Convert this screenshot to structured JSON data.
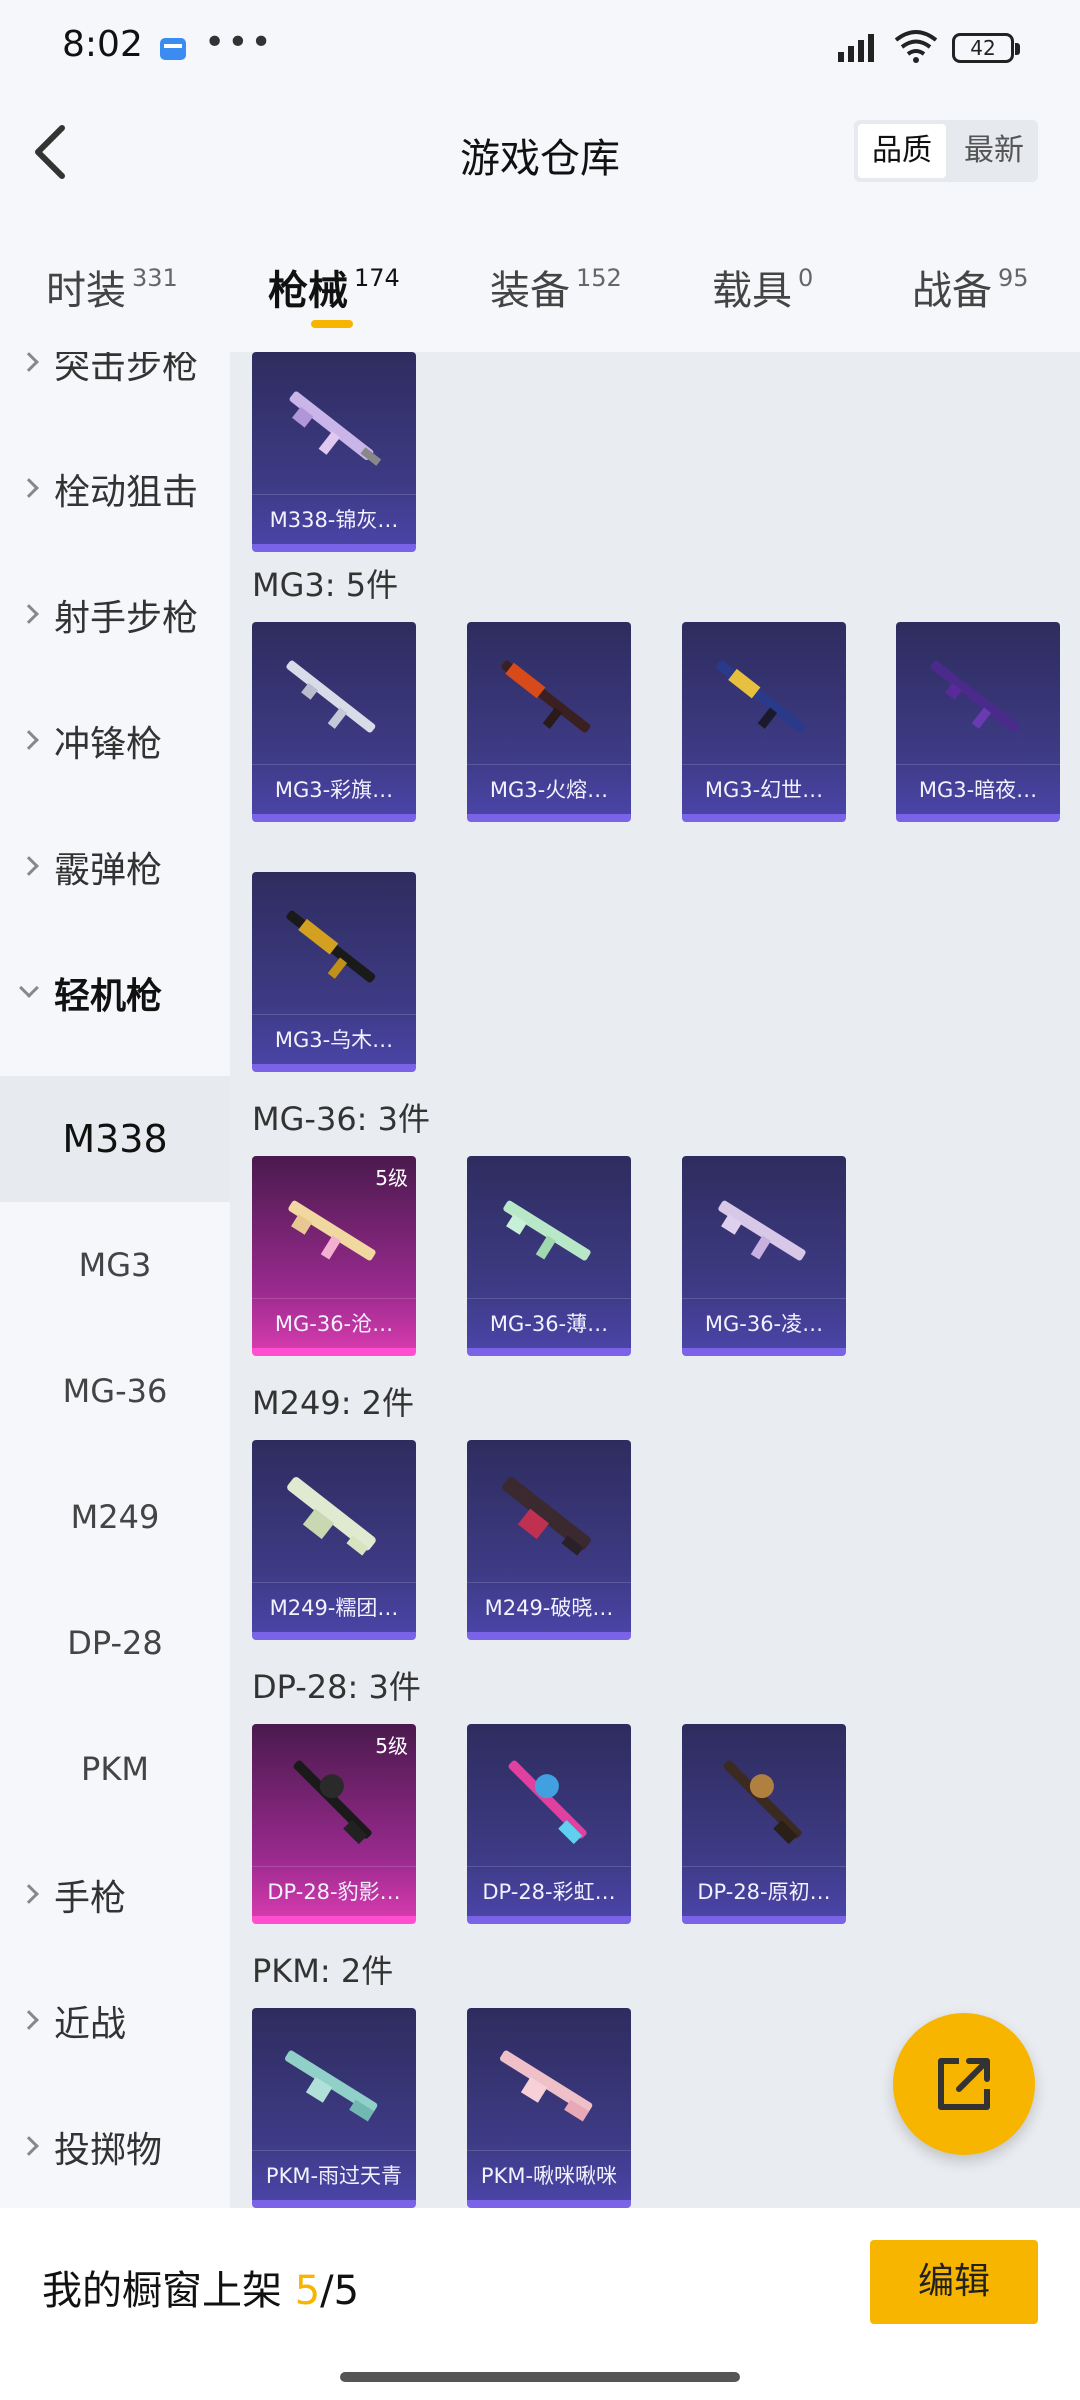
{
  "status_bar": {
    "time": "8:02",
    "dots": "•••",
    "battery": "42"
  },
  "header": {
    "title": "游戏仓库",
    "sort_quality": "品质",
    "sort_latest": "最新"
  },
  "tabs": [
    {
      "label": "时装",
      "count": "331"
    },
    {
      "label": "枪械",
      "count": "174"
    },
    {
      "label": "装备",
      "count": "152"
    },
    {
      "label": "载具",
      "count": "0"
    },
    {
      "label": "战备",
      "count": "95"
    }
  ],
  "sidebar": {
    "categories": [
      "突击步枪",
      "栓动狙击",
      "射手步枪",
      "冲锋枪",
      "霰弹枪",
      "轻机枪"
    ],
    "sub_items": [
      "M338",
      "MG3",
      "MG-36",
      "M249",
      "DP-28",
      "PKM"
    ],
    "more_categories": [
      "手枪",
      "近战",
      "投掷物"
    ]
  },
  "content": {
    "top_card": {
      "name": "M338-锦灰…"
    },
    "groups": [
      {
        "title": "MG3: 5件",
        "items": [
          "MG3-彩旗…",
          "MG3-火熔…",
          "MG3-幻世…",
          "MG3-暗夜…",
          "MG3-乌木…"
        ]
      },
      {
        "title": "MG-36: 3件",
        "items": [
          "MG-36-沧…",
          "MG-36-薄…",
          "MG-36-凌…"
        ],
        "badge": "5级"
      },
      {
        "title": "M249: 2件",
        "items": [
          "M249-糯团…",
          "M249-破晓…"
        ]
      },
      {
        "title": "DP-28: 3件",
        "items": [
          "DP-28-豹影…",
          "DP-28-彩虹…",
          "DP-28-原初…"
        ],
        "badge": "5级"
      },
      {
        "title": "PKM: 2件",
        "items": [
          "PKM-雨过天青",
          "PKM-啾咪啾咪"
        ]
      }
    ]
  },
  "bottom_bar": {
    "label": "我的橱窗上架",
    "current": "5",
    "total": "/5",
    "edit": "编辑"
  },
  "colors": {
    "accent": "#f7b500",
    "card_purple": "#3e3b86",
    "card_pink": "#9a2a8e"
  }
}
